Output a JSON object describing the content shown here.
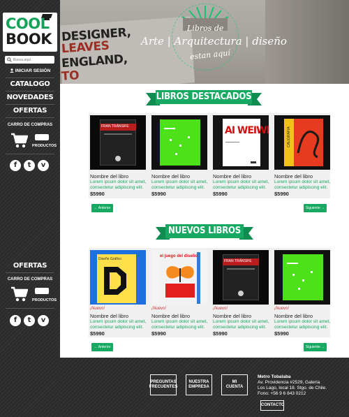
{
  "brand": {
    "line1": "COOL",
    "line2": "BOOK"
  },
  "search": {
    "placeholder": "Busca aquí"
  },
  "sidebar": {
    "login": "INICIAR SESIÓN",
    "nav": [
      "CATALOGO",
      "NOVEDADES",
      "OFERTAS"
    ],
    "cart_title": "CARRO DE COMPRAS",
    "cart_label": "PRODUCTOS",
    "offers2": "OFERTAS",
    "cart_title2": "CARRO DE COMPRAS",
    "cart_label2": "PRODUCTOS"
  },
  "hero": {
    "poster_lines": [
      "DESIGNER,",
      "LEAVES",
      "ENGLAND,",
      "TO"
    ],
    "text_top": "Libros de",
    "text_main": "Arte | Arquitectura | diseño",
    "text_bottom": "estan aquí"
  },
  "sections": {
    "featured": {
      "title": "LIBROS DESTACADOS",
      "books": [
        {
          "name": "Nombre del libro",
          "desc": "Lorem ipsum dolor sit amet, consectetur adipiscing elit.",
          "price": "$5990"
        },
        {
          "name": "Nombre del libro",
          "desc": "Lorem ipsum dolor sit amet, consectetur adipiscing elit.",
          "price": "$5990"
        },
        {
          "name": "Nombre del libro",
          "desc": "Lorem ipsum dolor sit amet, consectetur adipiscing elit.",
          "price": "$5990"
        },
        {
          "name": "Nombre del libro",
          "desc": "Lorem ipsum dolor sit amet, consectetur adipiscing elit.",
          "price": "$5990"
        }
      ],
      "prev": "← Anterior",
      "next": "Siguiente →"
    },
    "new": {
      "title": "NUEVOS LIBROS",
      "books": [
        {
          "tag": "¡Nuevo!",
          "name": "Nombre del libro",
          "desc": "Lorem ipsum dolor sit amet, consectetur adipiscing elit.",
          "price": "$5990"
        },
        {
          "tag": "¡Nuevo!",
          "name": "Nombre del libro",
          "desc": "Lorem ipsum dolor sit amet, consectetur adipiscing elit.",
          "price": "$5990"
        },
        {
          "tag": "¡Nuevo!",
          "name": "Nombre del libro",
          "desc": "Lorem ipsum dolor sit amet, consectetur adipiscing elit.",
          "price": "$5990"
        },
        {
          "tag": "¡Nuevo!",
          "name": "Nombre del libro",
          "desc": "Lorem ipsum dolor sit amet, consectetur adipiscing elit.",
          "price": "$5990"
        }
      ],
      "prev": "← Anterior",
      "next": "Siguiente →"
    }
  },
  "covers": {
    "b1_title": "FRAN TRÁNSIFE",
    "b3_title": "AI WEIWEI",
    "b4_title": "CALIGRAFIA",
    "n2_title": "el juego del diseño",
    "n1_title": "Diseño Gráfico"
  },
  "footer": {
    "faq": [
      "PREGUNTAS",
      "FRECUENTES"
    ],
    "company": [
      "NUESTRA",
      "EMPRESA"
    ],
    "account": [
      "MI",
      "CUENTA"
    ],
    "address": [
      "Metro Tobalaba",
      "Av. Providencia #2529, Galería",
      "Los Lago, local 18. Stgo. de Chile.",
      "Fono: +56 9 6 843 0212"
    ],
    "contact": "CONTACTO"
  },
  "colors": {
    "accent": "#17a862",
    "sidebar": "#2b2b2b",
    "tag": "#d32f2f"
  }
}
